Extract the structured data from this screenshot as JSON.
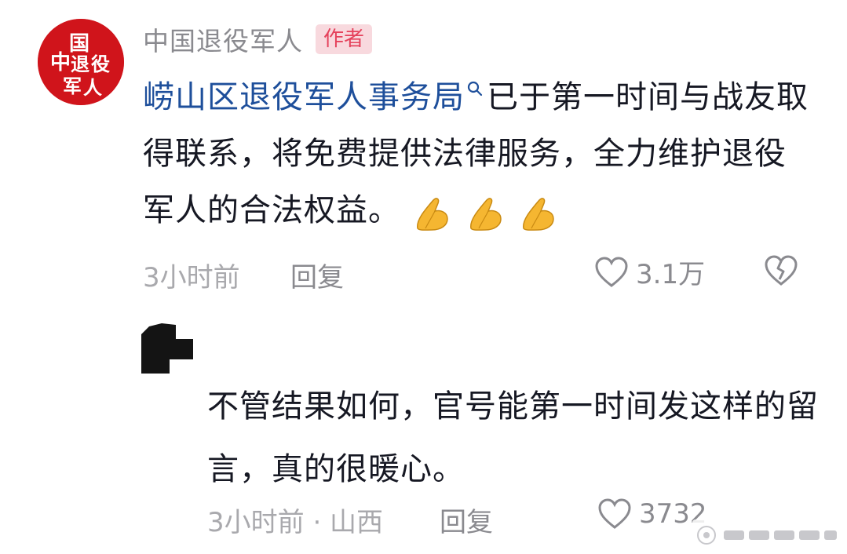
{
  "main_comment": {
    "author": "中国退役军人",
    "author_badge": "作者",
    "avatar_text": "中国退役军人",
    "mention": "崂山区退役军人事务局",
    "text": "已于第一时间与战友取得联系，将免费提供法律服务，全力维护退役军人的合法权益。",
    "emoji_icon": "pray-icon",
    "time": "3小时前",
    "reply_label": "回复",
    "like_count": "3.1万",
    "colors": {
      "mention": "#1e4f9b",
      "badge_bg": "#f8d9de",
      "badge_text": "#e5425c",
      "avatar_bg": "#d0141b"
    }
  },
  "reply_comment": {
    "text": "不管结果如何，官号能第一时间发这样的留言，真的很暖心。",
    "time_location": "3小时前 · 山西",
    "reply_label": "回复",
    "like_count": "3732"
  }
}
